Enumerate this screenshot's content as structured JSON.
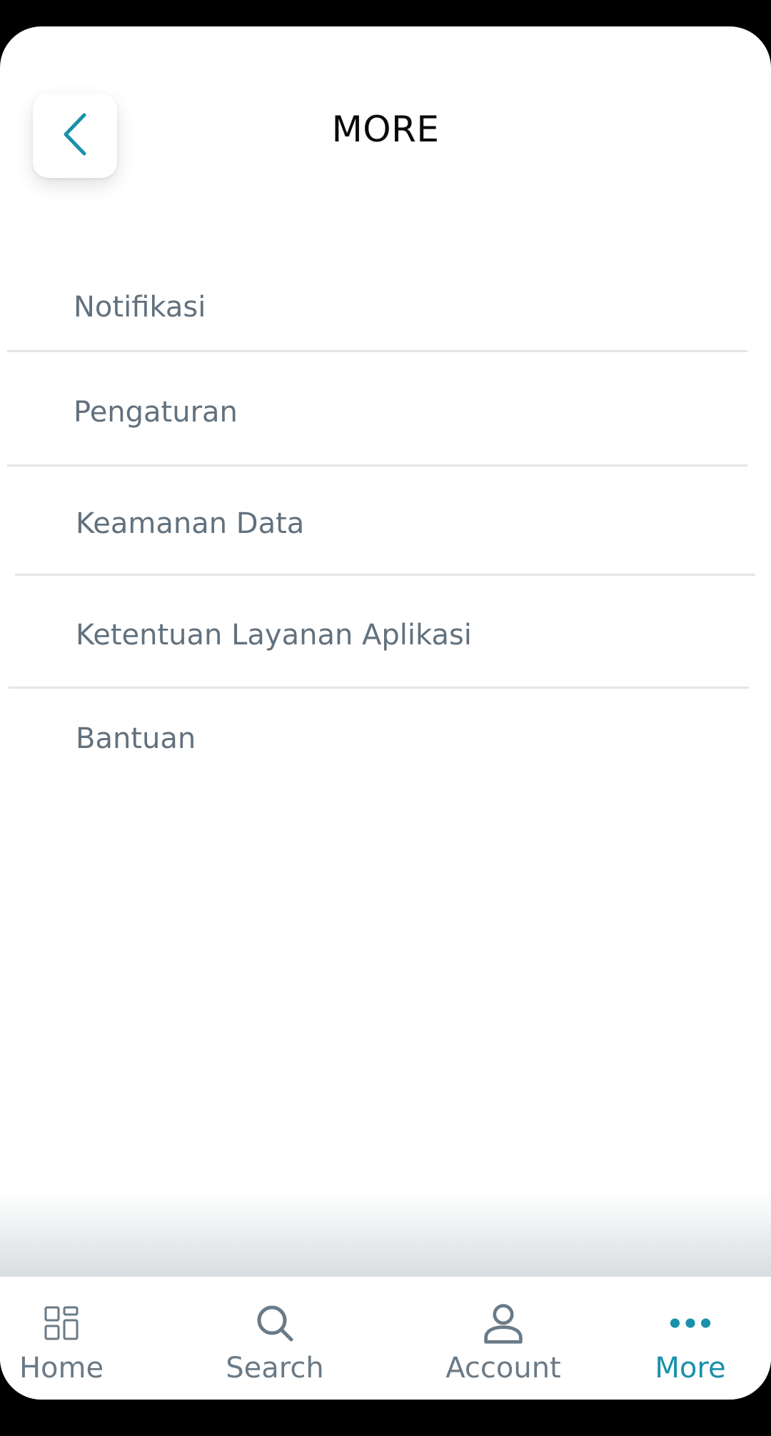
{
  "header": {
    "title": "MORE",
    "back_icon": "chevron-left-icon"
  },
  "menu": {
    "items": [
      {
        "label": "Notifikasi"
      },
      {
        "label": "Pengaturan"
      },
      {
        "label": "Keamanan Data"
      },
      {
        "label": "Ketentuan Layanan Aplikasi"
      },
      {
        "label": "Bantuan"
      }
    ]
  },
  "tabbar": {
    "tabs": [
      {
        "label": "Home",
        "icon": "grid-icon",
        "active": false
      },
      {
        "label": "Search",
        "icon": "search-icon",
        "active": false
      },
      {
        "label": "Account",
        "icon": "person-icon",
        "active": false
      },
      {
        "label": "More",
        "icon": "more-dots-icon",
        "active": true
      }
    ]
  },
  "colors": {
    "accent": "#1991aa",
    "menu_text": "#62717e",
    "tab_inactive": "#6a7a86",
    "divider": "#e3e6e8",
    "title": "#0a0a0a"
  }
}
